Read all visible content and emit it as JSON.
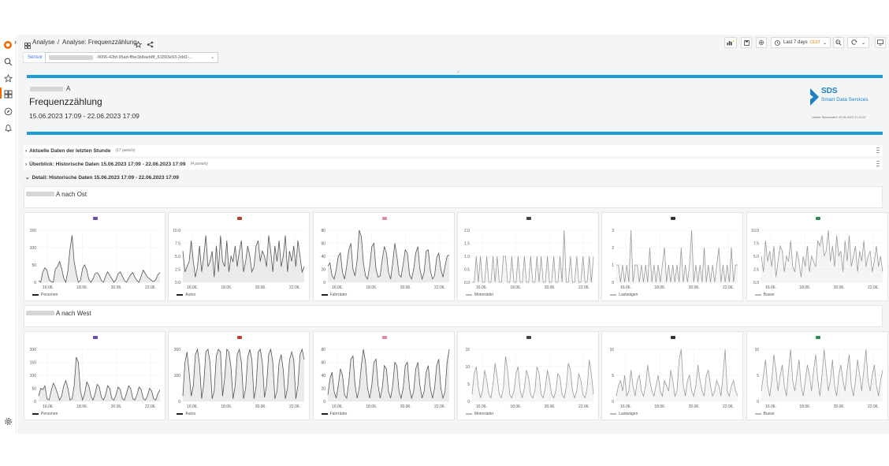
{
  "breadcrumb": {
    "root": "Analyse",
    "sep": "/",
    "page": "Analyse: Frequenzzählung"
  },
  "toolbar": {
    "time_range": "Last 7 days",
    "timezone": "CEST"
  },
  "variable": {
    "label": "Sensor",
    "value": "-9006-42bf-95ad-ffbe3b8aeb8f_61893e93-2dd1-..."
  },
  "header": {
    "location_suffix": "A",
    "title": "Frequenzzählung",
    "date_range": "15.06.2023 17:09 - 22.06.2023 17:09",
    "logo_text": "SDS",
    "logo_subtext": "Smart Data Services",
    "last_value": "Letzter Sensorwert: 22.06.2023 17:10:07"
  },
  "rows": [
    {
      "title": "Aktuelle Daten der letzten Stunde",
      "count": "(17 panels)",
      "collapsed": true
    },
    {
      "title": "Überblick: Historische Daten 15.06.2023 17:09 - 22.06.2023 17:09",
      "count": "(4 panels)",
      "collapsed": true
    },
    {
      "title": "Detail: Historische Daten 15.06.2023 17:09 - 22.06.2023 17:09",
      "count": "",
      "collapsed": false
    }
  ],
  "directions": {
    "east": "A nach Ost",
    "west": "A nach West"
  },
  "x_ticks": [
    "16.06.",
    "18.06.",
    "20.06.",
    "22.06."
  ],
  "colors": {
    "accent": "#1e9ad8",
    "dark_series": "#555555",
    "light_series": "#9a9a9a"
  },
  "chart_data": [
    {
      "type": "area",
      "group": "east",
      "legend": "Personen",
      "icon": "people",
      "ylim": [
        0,
        150
      ],
      "yticks": [
        "150",
        "100",
        "50",
        "0"
      ],
      "values": [
        5,
        0,
        30,
        42,
        35,
        8,
        2,
        0,
        38,
        45,
        60,
        40,
        12,
        0,
        35,
        95,
        135,
        60,
        25,
        0,
        5,
        40,
        50,
        35,
        8,
        0,
        10,
        25,
        28,
        20,
        5,
        0,
        18,
        30,
        20,
        10,
        0,
        8,
        25,
        30,
        18,
        5,
        0,
        12,
        22,
        28,
        15,
        5,
        0,
        18,
        35,
        25,
        15,
        10,
        5,
        2,
        8,
        22,
        28
      ]
    },
    {
      "type": "area",
      "group": "east",
      "legend": "Autos",
      "icon": "car",
      "ylim": [
        0,
        10
      ],
      "yticks": [
        "10.0",
        "7.5",
        "5.0",
        "2.5",
        "0.0"
      ],
      "values": [
        6,
        2,
        3,
        4,
        8,
        4,
        1,
        3,
        7,
        2,
        5,
        9,
        3,
        4,
        6,
        1,
        7,
        2,
        9,
        4,
        3,
        8,
        2,
        5,
        4,
        7,
        3,
        6,
        8,
        2,
        4,
        7,
        5,
        2,
        3,
        7,
        8,
        4,
        6,
        5,
        3,
        9,
        6,
        2,
        7,
        4,
        8,
        3,
        5,
        9,
        2,
        6,
        4,
        7,
        3,
        8,
        5,
        2,
        3
      ]
    },
    {
      "type": "area",
      "group": "east",
      "legend": "Fahrräder",
      "icon": "bike",
      "ylim": [
        0,
        80
      ],
      "yticks": [
        "80",
        "60",
        "40",
        "20",
        "0"
      ],
      "values": [
        25,
        30,
        10,
        5,
        20,
        40,
        45,
        15,
        5,
        25,
        50,
        60,
        20,
        10,
        35,
        80,
        70,
        30,
        10,
        5,
        25,
        55,
        60,
        20,
        8,
        10,
        35,
        55,
        45,
        15,
        5,
        30,
        60,
        40,
        12,
        8,
        28,
        50,
        45,
        12,
        5,
        20,
        45,
        55,
        20,
        5,
        15,
        48,
        50,
        18,
        5,
        10,
        38,
        45,
        20,
        8,
        25,
        40,
        42
      ]
    },
    {
      "type": "area",
      "group": "east",
      "legend": "Motorräder",
      "icon": "moto",
      "ylim": [
        0,
        2
      ],
      "yticks": [
        "2.0",
        "1.5",
        "1.0",
        "0.5",
        "0.0"
      ],
      "values": [
        0,
        0,
        1,
        0,
        1,
        0,
        0,
        1,
        0,
        0,
        1,
        0,
        1,
        0,
        0,
        1,
        1,
        0,
        0,
        1,
        0,
        0,
        1,
        0,
        0,
        1,
        0,
        0,
        1,
        0,
        0,
        1,
        0,
        1,
        0,
        0,
        1,
        0,
        0,
        1,
        0,
        0,
        1,
        0,
        2,
        0,
        0,
        1,
        0,
        0,
        1,
        0,
        0,
        1,
        0,
        0,
        1,
        0,
        1
      ]
    },
    {
      "type": "area",
      "group": "east",
      "legend": "Lastwägen",
      "icon": "truck",
      "ylim": [
        0,
        3
      ],
      "yticks": [
        "3",
        "2",
        "1",
        "0"
      ],
      "values": [
        1,
        1,
        0,
        1,
        0,
        1,
        0,
        3,
        0,
        1,
        1,
        0,
        1,
        0,
        1,
        0,
        2,
        0,
        1,
        0,
        1,
        0,
        1,
        2,
        0,
        1,
        0,
        1,
        0,
        1,
        0,
        2,
        0,
        1,
        0,
        1,
        3,
        0,
        1,
        0,
        1,
        0,
        2,
        0,
        1,
        0,
        1,
        0,
        1,
        2,
        0,
        1,
        0,
        1,
        0,
        2,
        0,
        1,
        1
      ]
    },
    {
      "type": "area",
      "group": "east",
      "legend": "Busse",
      "icon": "bus",
      "ylim": [
        0,
        10
      ],
      "yticks": [
        "10.0",
        "7.5",
        "5.0",
        "2.5",
        "0.0"
      ],
      "values": [
        5,
        2,
        8,
        4,
        6,
        3,
        7,
        1,
        4,
        7,
        6,
        2,
        5,
        4,
        8,
        3,
        2,
        6,
        4,
        1,
        5,
        3,
        7,
        2,
        5,
        4,
        3,
        8,
        7,
        9,
        5,
        6,
        10,
        4,
        7,
        3,
        9,
        5,
        6,
        2,
        8,
        4,
        9,
        3,
        5,
        7,
        2,
        6,
        4,
        8,
        3,
        5,
        6,
        2,
        4,
        7,
        3,
        5,
        2
      ]
    },
    {
      "type": "area",
      "group": "west",
      "legend": "Personen",
      "icon": "people",
      "ylim": [
        0,
        200
      ],
      "yticks": [
        "200",
        "150",
        "100",
        "50",
        "0"
      ],
      "values": [
        20,
        50,
        45,
        60,
        10,
        5,
        40,
        70,
        55,
        30,
        5,
        20,
        60,
        80,
        50,
        5,
        10,
        60,
        170,
        150,
        40,
        5,
        30,
        75,
        60,
        20,
        5,
        30,
        65,
        55,
        15,
        5,
        25,
        60,
        50,
        10,
        5,
        25,
        55,
        45,
        10,
        5,
        30,
        60,
        50,
        10,
        5,
        25,
        55,
        45,
        10,
        5,
        20,
        50,
        40,
        10,
        5,
        30,
        45
      ]
    },
    {
      "type": "area",
      "group": "west",
      "legend": "Autos",
      "icon": "car",
      "ylim": [
        0,
        200
      ],
      "yticks": [
        "200",
        "100",
        "0"
      ],
      "values": [
        20,
        150,
        190,
        110,
        20,
        60,
        180,
        200,
        140,
        10,
        70,
        190,
        200,
        150,
        10,
        40,
        175,
        230,
        190,
        20,
        90,
        210,
        190,
        130,
        10,
        60,
        180,
        210,
        150,
        10,
        50,
        170,
        200,
        160,
        10,
        55,
        190,
        220,
        150,
        15,
        60,
        180,
        200,
        150,
        10,
        40,
        150,
        180,
        120,
        10,
        50,
        160,
        190,
        160,
        10,
        60,
        180,
        210,
        160
      ]
    },
    {
      "type": "area",
      "group": "west",
      "legend": "Fahrräder",
      "icon": "bike",
      "ylim": [
        0,
        80
      ],
      "yticks": [
        "80",
        "60",
        "40",
        "20",
        "0"
      ],
      "values": [
        10,
        35,
        45,
        15,
        5,
        25,
        50,
        40,
        10,
        5,
        30,
        65,
        70,
        25,
        5,
        20,
        55,
        85,
        60,
        20,
        5,
        25,
        60,
        65,
        25,
        5,
        20,
        55,
        50,
        15,
        5,
        25,
        60,
        55,
        15,
        5,
        20,
        55,
        60,
        20,
        5,
        15,
        50,
        60,
        25,
        5,
        15,
        45,
        55,
        20,
        5,
        20,
        55,
        65,
        20,
        5,
        15,
        60,
        85
      ]
    },
    {
      "type": "area",
      "group": "west",
      "legend": "Motorräder",
      "icon": "moto",
      "ylim": [
        0,
        15
      ],
      "yticks": [
        "15",
        "10",
        "5",
        "0"
      ],
      "values": [
        2,
        8,
        10,
        4,
        1,
        3,
        9,
        6,
        2,
        1,
        5,
        11,
        7,
        2,
        1,
        4,
        13,
        9,
        2,
        1,
        3,
        8,
        10,
        3,
        1,
        4,
        9,
        7,
        2,
        1,
        3,
        10,
        8,
        2,
        1,
        4,
        9,
        6,
        2,
        1,
        3,
        8,
        7,
        2,
        1,
        4,
        11,
        9,
        3,
        1,
        3,
        8,
        6,
        2,
        1,
        4,
        12,
        8,
        2
      ]
    },
    {
      "type": "area",
      "group": "west",
      "legend": "Lastwägen",
      "icon": "truck",
      "ylim": [
        0,
        10
      ],
      "yticks": [
        "10",
        "5",
        "0"
      ],
      "values": [
        1,
        3,
        4,
        2,
        5,
        1,
        2,
        6,
        3,
        1,
        4,
        5,
        2,
        1,
        3,
        7,
        4,
        2,
        1,
        3,
        5,
        2,
        1,
        4,
        3,
        2,
        6,
        4,
        1,
        2,
        8,
        11,
        3,
        1,
        4,
        5,
        2,
        1,
        3,
        7,
        4,
        2,
        1,
        5,
        6,
        3,
        1,
        2,
        4,
        3,
        1,
        5,
        10,
        2,
        1,
        3,
        4,
        2,
        1
      ]
    },
    {
      "type": "area",
      "group": "west",
      "legend": "Busse",
      "icon": "bus",
      "ylim": [
        0,
        10
      ],
      "yticks": [
        "10",
        "5",
        "0"
      ],
      "values": [
        2,
        5,
        8,
        3,
        1,
        4,
        9,
        6,
        2,
        5,
        7,
        3,
        1,
        6,
        10,
        4,
        2,
        5,
        8,
        3,
        1,
        4,
        7,
        5,
        2,
        6,
        9,
        4,
        1,
        5,
        11,
        6,
        2,
        4,
        8,
        3,
        1,
        5,
        7,
        4,
        2,
        6,
        9,
        3,
        1,
        4,
        8,
        5,
        2,
        6,
        10,
        4,
        2,
        5,
        7,
        3,
        1,
        4,
        6
      ]
    }
  ]
}
